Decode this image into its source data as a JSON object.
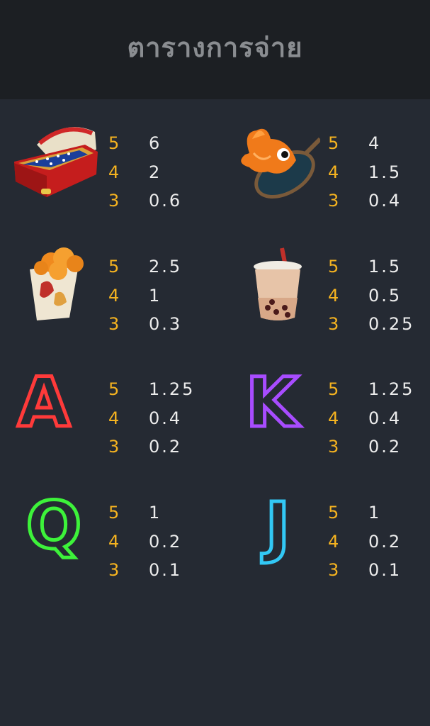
{
  "header": {
    "title": "ตารางการจ่าย"
  },
  "symbols": [
    {
      "name": "pinball-machine",
      "pays": [
        {
          "count": "5",
          "value": "6"
        },
        {
          "count": "4",
          "value": "2"
        },
        {
          "count": "3",
          "value": "0.6"
        }
      ]
    },
    {
      "name": "goldfish-net",
      "pays": [
        {
          "count": "5",
          "value": "4"
        },
        {
          "count": "4",
          "value": "1.5"
        },
        {
          "count": "3",
          "value": "0.4"
        }
      ]
    },
    {
      "name": "popcorn",
      "pays": [
        {
          "count": "5",
          "value": "2.5"
        },
        {
          "count": "4",
          "value": "1"
        },
        {
          "count": "3",
          "value": "0.3"
        }
      ]
    },
    {
      "name": "bubble-tea",
      "pays": [
        {
          "count": "5",
          "value": "1.5"
        },
        {
          "count": "4",
          "value": "0.5"
        },
        {
          "count": "3",
          "value": "0.25"
        }
      ]
    },
    {
      "name": "letter-a",
      "letter": "A",
      "color": "#e8202a",
      "pays": [
        {
          "count": "5",
          "value": "1.25"
        },
        {
          "count": "4",
          "value": "0.4"
        },
        {
          "count": "3",
          "value": "0.2"
        }
      ]
    },
    {
      "name": "letter-k",
      "letter": "K",
      "color": "#9b3cf0",
      "pays": [
        {
          "count": "5",
          "value": "1.25"
        },
        {
          "count": "4",
          "value": "0.4"
        },
        {
          "count": "3",
          "value": "0.2"
        }
      ]
    },
    {
      "name": "letter-q",
      "letter": "Q",
      "color": "#2fd12c",
      "pays": [
        {
          "count": "5",
          "value": "1"
        },
        {
          "count": "4",
          "value": "0.2"
        },
        {
          "count": "3",
          "value": "0.1"
        }
      ]
    },
    {
      "name": "letter-j",
      "letter": "J",
      "color": "#25b8e8",
      "pays": [
        {
          "count": "5",
          "value": "1"
        },
        {
          "count": "4",
          "value": "0.2"
        },
        {
          "count": "3",
          "value": "0.1"
        }
      ]
    }
  ],
  "colors": {
    "count": "#f5b320",
    "value": "#ececec",
    "background": "#252a33",
    "header": "#1c1f23"
  }
}
